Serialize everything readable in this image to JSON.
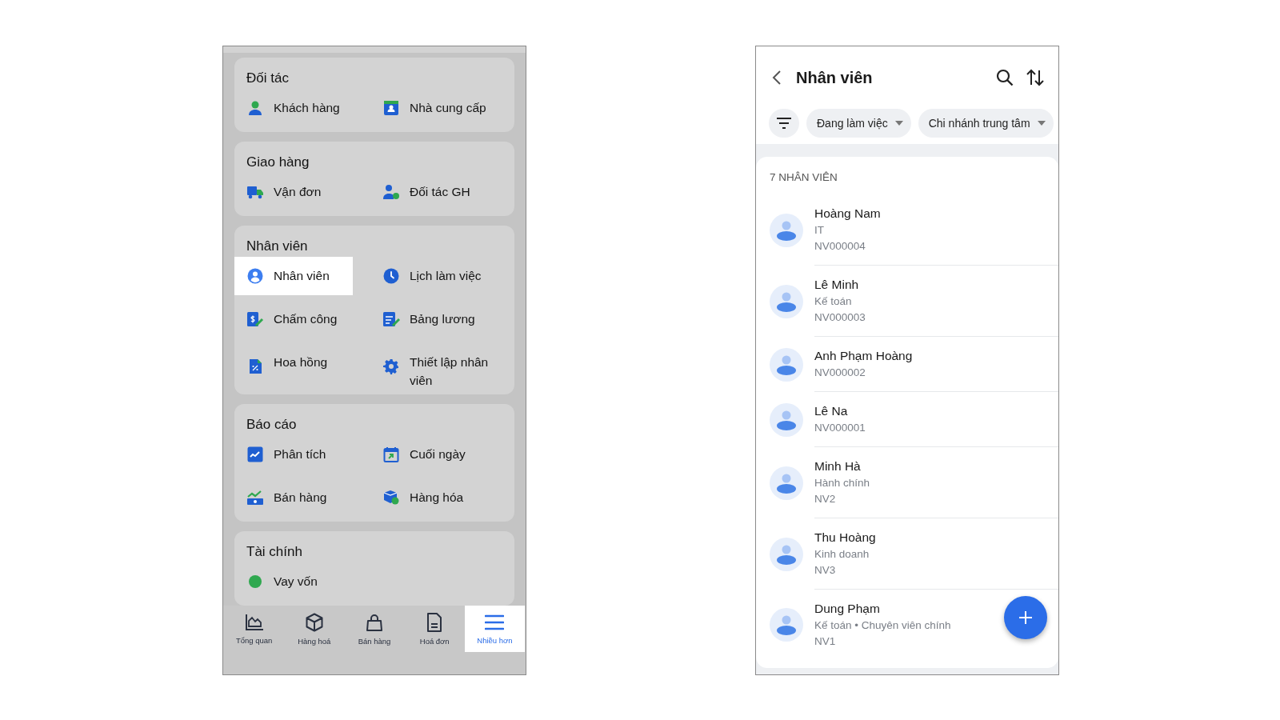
{
  "menu": {
    "sections": [
      {
        "title": "Đối tác",
        "items": [
          {
            "label": "Khách hàng",
            "selected": false
          },
          {
            "label": "Nhà cung cấp",
            "selected": false
          }
        ]
      },
      {
        "title": "Giao hàng",
        "items": [
          {
            "label": "Vận đơn",
            "selected": false
          },
          {
            "label": "Đối tác GH",
            "selected": false
          }
        ]
      },
      {
        "title": "Nhân viên",
        "items": [
          {
            "label": "Nhân viên",
            "selected": true
          },
          {
            "label": "Lịch làm việc",
            "selected": false
          },
          {
            "label": "Chấm công",
            "selected": false
          },
          {
            "label": "Bảng lương",
            "selected": false
          },
          {
            "label": "Hoa hồng",
            "selected": false
          },
          {
            "label": "Thiết lập nhân viên",
            "selected": false
          }
        ]
      },
      {
        "title": "Báo cáo",
        "items": [
          {
            "label": "Phân tích",
            "selected": false
          },
          {
            "label": "Cuối ngày",
            "selected": false
          },
          {
            "label": "Bán hàng",
            "selected": false
          },
          {
            "label": "Hàng hóa",
            "selected": false
          }
        ]
      },
      {
        "title": "Tài chính",
        "items": [
          {
            "label": "Vay vốn",
            "selected": false
          }
        ]
      }
    ]
  },
  "bottom_nav": [
    {
      "label": "Tổng quan",
      "selected": false
    },
    {
      "label": "Hàng hoá",
      "selected": false
    },
    {
      "label": "Bán hàng",
      "selected": false
    },
    {
      "label": "Hoá đơn",
      "selected": false
    },
    {
      "label": "Nhiều hơn",
      "selected": true
    }
  ],
  "employees_screen": {
    "title": "Nhân viên",
    "chips": [
      {
        "label": "Đang làm việc"
      },
      {
        "label": "Chi nhánh trung tâm"
      }
    ],
    "count": "7 NHÂN VIÊN",
    "employees": [
      {
        "name": "Hoàng Nam",
        "details": [
          "IT",
          "NV000004"
        ]
      },
      {
        "name": "Lê Minh",
        "details": [
          "Kế toán",
          "NV000003"
        ]
      },
      {
        "name": "Anh Phạm Hoàng",
        "details": [
          "NV000002"
        ]
      },
      {
        "name": "Lê Na",
        "details": [
          "NV000001"
        ]
      },
      {
        "name": "Minh Hà",
        "details": [
          "Hành chính",
          "NV2"
        ]
      },
      {
        "name": "Thu Hoàng",
        "details": [
          "Kinh doanh",
          "NV3"
        ]
      },
      {
        "name": "Dung Phạm",
        "details": [
          "Kế toán • Chuyên viên chính",
          "NV1"
        ]
      }
    ]
  }
}
